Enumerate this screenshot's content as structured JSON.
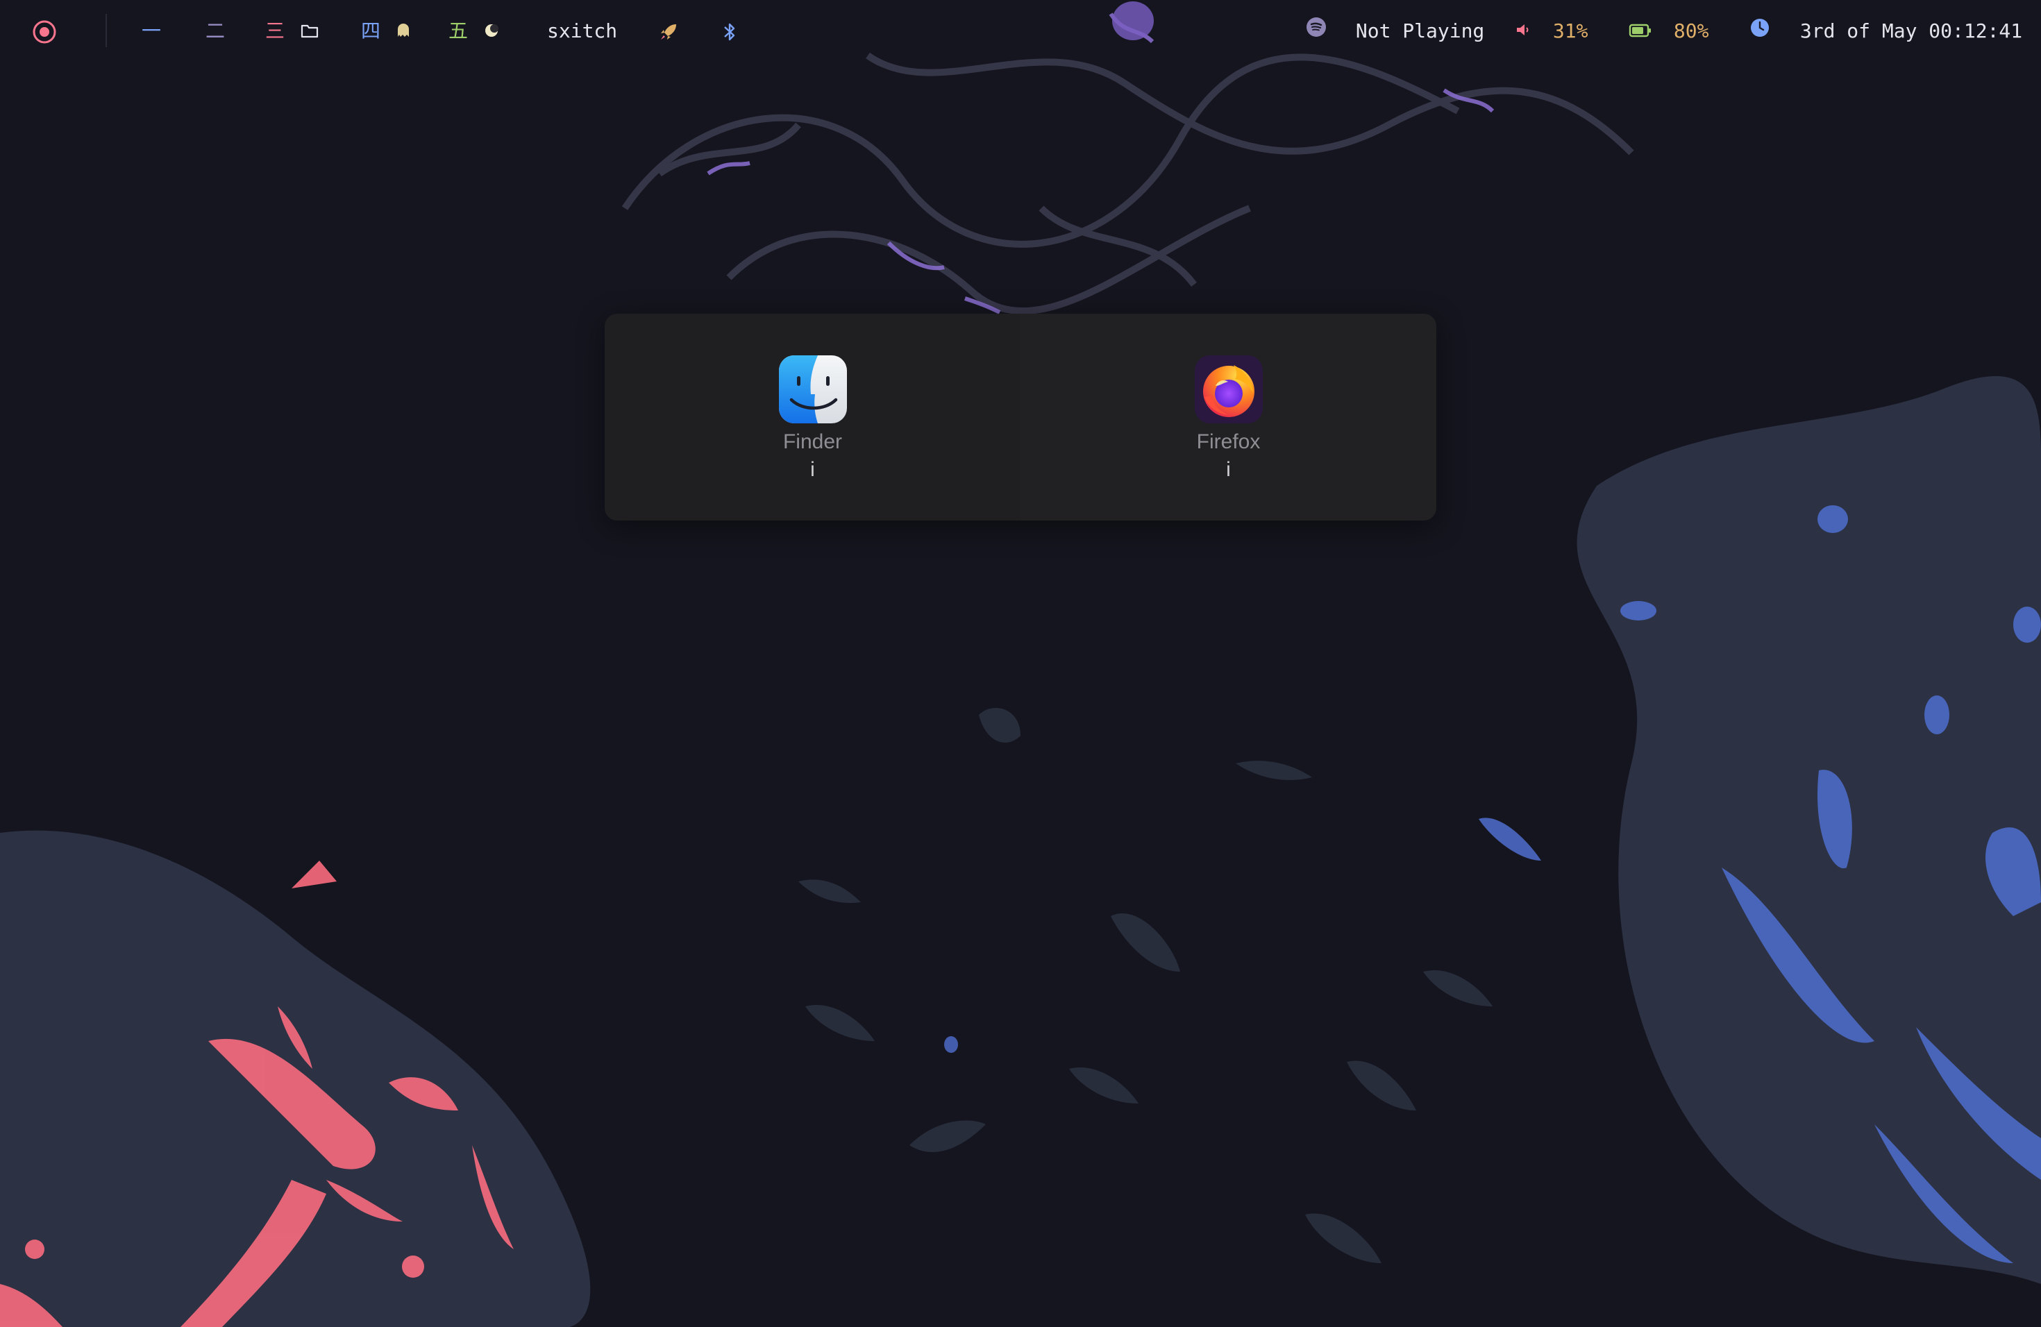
{
  "topbar": {
    "logo_icon": "record-circle-icon",
    "spaces": [
      {
        "glyph": "一",
        "icon": null,
        "color": "#7aa2f7"
      },
      {
        "glyph": "二",
        "icon": null,
        "color": "#9b8ec7"
      },
      {
        "glyph": "三",
        "icon": "folder-icon",
        "color": "#f7768e"
      },
      {
        "glyph": "四",
        "icon": "ghost-icon",
        "color": "#7aa2f7"
      },
      {
        "glyph": "五",
        "icon": "moon-icon",
        "color": "#9ece6a"
      }
    ],
    "front_app": "sxitch",
    "rocket_icon": "rocket-icon",
    "bluetooth_icon": "bluetooth-icon",
    "music": {
      "icon": "spotify-icon",
      "label": "Not Playing"
    },
    "volume": {
      "icon": "speaker-icon",
      "label": "31%"
    },
    "battery": {
      "icon": "battery-icon",
      "label": "80%",
      "level": 0.8
    },
    "clock": {
      "icon": "clock-icon",
      "label": "3rd of May 00:12:41"
    },
    "colors": {
      "accent_pink": "#f7768e",
      "accent_blue": "#7aa2f7",
      "accent_green": "#9ece6a",
      "accent_yellow": "#e0af68",
      "accent_purple": "#bb9af7"
    }
  },
  "switcher": {
    "apps": [
      {
        "name": "Finder",
        "key": "i",
        "icon": "finder-icon"
      },
      {
        "name": "Firefox",
        "key": "i",
        "icon": "firefox-icon"
      }
    ]
  }
}
